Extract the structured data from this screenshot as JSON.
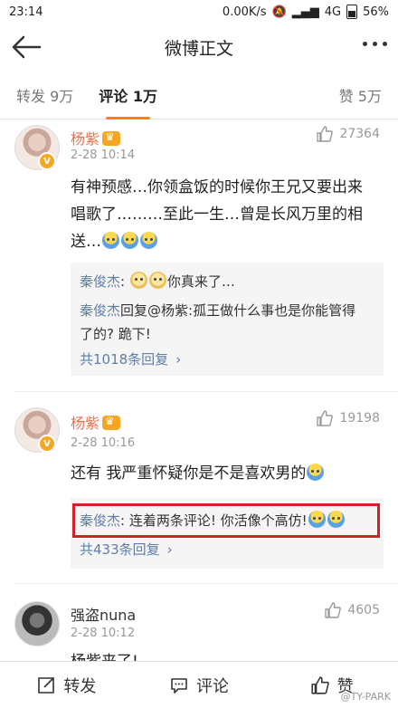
{
  "status": {
    "time": "23:14",
    "network_speed": "0.00K/s",
    "network_type": "4G",
    "battery": "56%"
  },
  "nav": {
    "title": "微博正文"
  },
  "tabs": {
    "repost": "转发 9万",
    "comment": "评论 1万",
    "likes": "赞 5万"
  },
  "comments": [
    {
      "user": "杨紫",
      "time": "2-28 10:14",
      "likes": "27364",
      "text_1": "有神预感…你领盒饭的时候你王兄又要出来",
      "text_2": "唱歌了………至此一生…曾是长风万里的相",
      "text_3": "送…",
      "replies": [
        {
          "author": "秦俊杰",
          "text": "你真来了…"
        },
        {
          "author": "秦俊杰",
          "text_1": "回复@杨紫:孤王做什么事也是你能管得",
          "text_2": "了的? 跪下!"
        }
      ],
      "more": "共1018条回复"
    },
    {
      "user": "杨紫",
      "time": "2-28 10:16",
      "likes": "19198",
      "text_1": "还有 我严重怀疑你是不是喜欢男的",
      "replies": [
        {
          "author": "秦俊杰",
          "text": ": 连着两条评论! 你活像个高仿!"
        }
      ],
      "more": "共433条回复"
    },
    {
      "user": "强盗nuna",
      "time": "2-28 10:12",
      "likes": "4605",
      "text_1": "杨紫来了!"
    }
  ],
  "bottom": {
    "repost": "转发",
    "comment": "评论",
    "like": "赞"
  },
  "watermark": "@TY-PARK"
}
